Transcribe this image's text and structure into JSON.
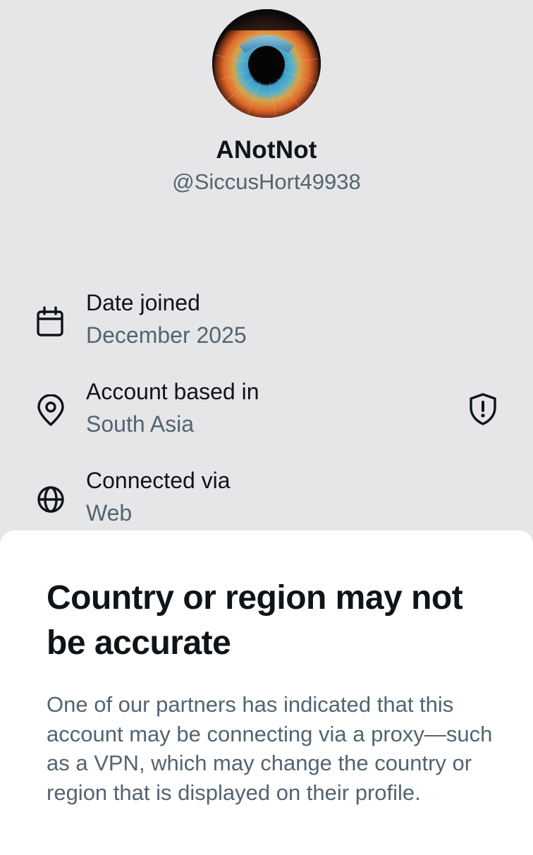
{
  "profile": {
    "display_name": "ANotNot",
    "handle": "@SiccusHort49938",
    "avatar_icon": "eye-avatar"
  },
  "details": {
    "date_joined": {
      "label": "Date joined",
      "value": "December 2025",
      "icon": "calendar-icon"
    },
    "account_based": {
      "label": "Account based in",
      "value": "South Asia",
      "icon": "location-pin-icon",
      "badge_icon": "shield-exclamation-icon"
    },
    "connected_via": {
      "label": "Connected via",
      "value": "Web",
      "icon": "globe-icon"
    }
  },
  "sheet": {
    "title": "Country or region may not be accurate",
    "body": "One of our partners has indicated that this account may be connecting via a proxy—such as a VPN, which may change the country or region that is displayed on their profile."
  },
  "colors": {
    "background": "#e6e6e8",
    "primary_text": "#0f1419",
    "secondary_text": "#536471",
    "sheet_background": "#ffffff"
  }
}
